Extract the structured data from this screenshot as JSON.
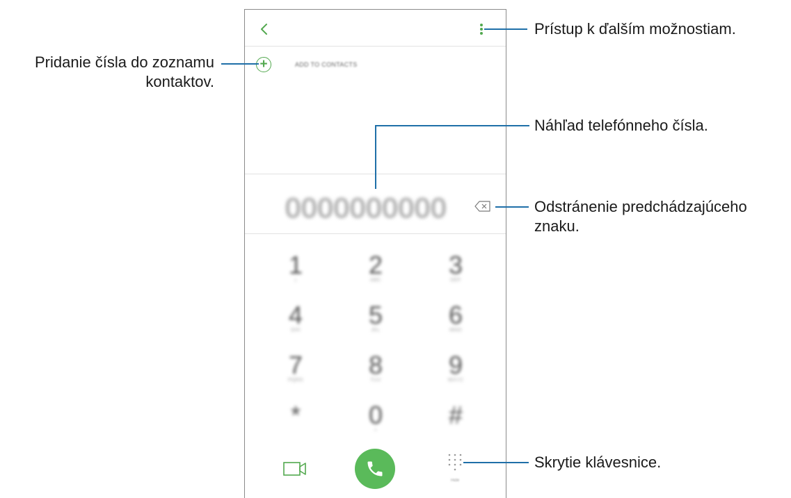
{
  "dialer": {
    "add_to_contacts_label": "ADD TO CONTACTS",
    "number_display": "0000000000",
    "keys": [
      {
        "digit": "1",
        "letters": "Ⅰ"
      },
      {
        "digit": "2",
        "letters": "ABC"
      },
      {
        "digit": "3",
        "letters": "DEF"
      },
      {
        "digit": "4",
        "letters": "GHI"
      },
      {
        "digit": "5",
        "letters": "JKL"
      },
      {
        "digit": "6",
        "letters": "MNO"
      },
      {
        "digit": "7",
        "letters": "PQRS"
      },
      {
        "digit": "8",
        "letters": "TUV"
      },
      {
        "digit": "9",
        "letters": "WXYZ"
      },
      {
        "digit": "*",
        "letters": ""
      },
      {
        "digit": "0",
        "letters": "+"
      },
      {
        "digit": "#",
        "letters": ""
      }
    ],
    "hide_label": "Hide",
    "accent_color": "#52a84e",
    "call_button_color": "#5aba5a",
    "icons": [
      "chevron-left-icon",
      "more-vert-icon",
      "plus-icon",
      "backspace-icon",
      "video-call-icon",
      "phone-icon",
      "keypad-icon"
    ]
  },
  "callouts": {
    "more_options": "Prístup k ďalším možnostiam.",
    "add_number_line1": "Pridanie čísla do zoznamu",
    "add_number_line2": "kontaktov.",
    "preview": "Náhľad telefónneho čísla.",
    "delete_line1": "Odstránenie predchádzajúceho",
    "delete_line2": "znaku.",
    "hide_keypad": "Skrytie klávesnice."
  },
  "callout_color": "#1e6fa8"
}
